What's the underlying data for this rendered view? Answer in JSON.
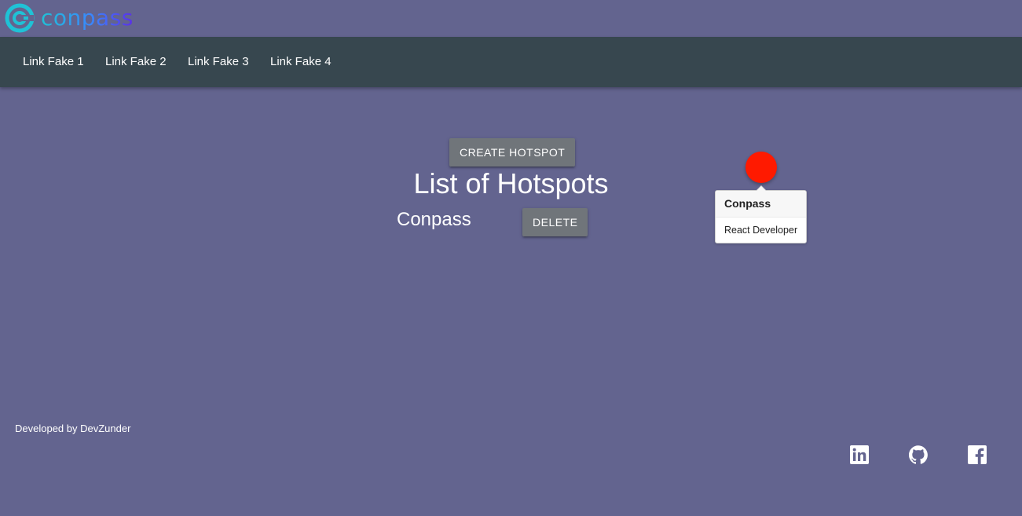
{
  "brand": {
    "name": "conpass",
    "logo_icon": "conpass-logo-icon",
    "gradient": [
      "#1fc2d6",
      "#3a86ff",
      "#5b2ee8"
    ]
  },
  "nav": {
    "links": [
      {
        "label": "Link Fake 1"
      },
      {
        "label": "Link Fake 2"
      },
      {
        "label": "Link Fake 3"
      },
      {
        "label": "Link Fake 4"
      }
    ]
  },
  "main": {
    "create_button": "Create Hotspot",
    "title": "List of Hotspots",
    "hotspots": [
      {
        "name": "Conpass",
        "delete_label": "Delete"
      }
    ]
  },
  "hotspot_marker": {
    "color": "#ff1a00",
    "tooltip": {
      "title": "Conpass",
      "description": "React Developer"
    }
  },
  "footer": {
    "credit": "Developed by DevZunder",
    "social": [
      {
        "icon": "linkedin-icon"
      },
      {
        "icon": "github-icon"
      },
      {
        "icon": "facebook-icon"
      }
    ]
  },
  "colors": {
    "background": "#63648f",
    "navbar": "#37474f",
    "button": "#70757a",
    "marker": "#ff1a00"
  }
}
